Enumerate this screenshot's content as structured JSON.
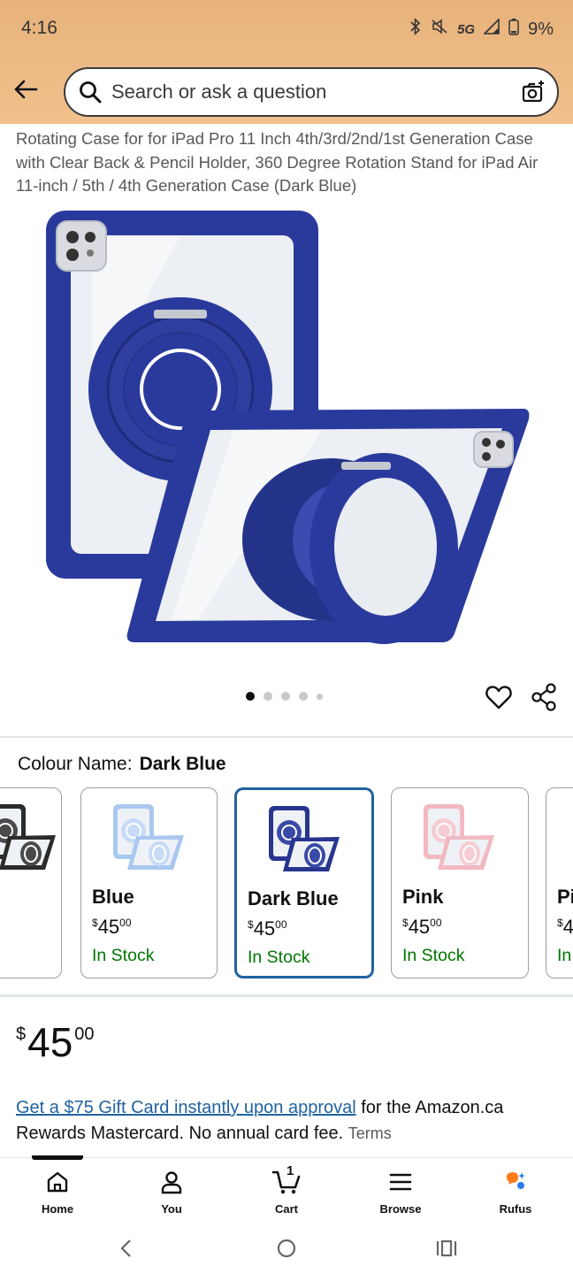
{
  "status_bar": {
    "time": "4:16",
    "network": "5G",
    "battery": "9%"
  },
  "search": {
    "placeholder": "Search or ask a question"
  },
  "product": {
    "title": "Rotating Case for for iPad Pro 11 Inch 4th/3rd/2nd/1st Generation Case with Clear Back & Pencil Holder, 360 Degree Rotation Stand for iPad Air 11-inch / 5th / 4th Generation Case (Dark Blue)",
    "image_count": 5,
    "active_image_index": 0
  },
  "colour": {
    "label": "Colour Name:",
    "value": "Dark Blue",
    "options": [
      {
        "name": "",
        "price_currency": "",
        "price_whole": "",
        "price_fraction": "",
        "stock": "",
        "tint": "#2b2b2b",
        "ring": "#4a4a4a"
      },
      {
        "name": "Blue",
        "price_currency": "$",
        "price_whole": "45",
        "price_fraction": "00",
        "stock": "In Stock",
        "tint": "#a9c8f0",
        "ring": "#c7dbf6"
      },
      {
        "name": "Dark Blue",
        "price_currency": "$",
        "price_whole": "45",
        "price_fraction": "00",
        "stock": "In Stock",
        "tint": "#27358f",
        "ring": "#3a4aa6"
      },
      {
        "name": "Pink",
        "price_currency": "$",
        "price_whole": "45",
        "price_fraction": "00",
        "stock": "In Stock",
        "tint": "#f2b9c2",
        "ring": "#f6cdd3"
      },
      {
        "name": "Pi",
        "price_currency": "$",
        "price_whole": "4",
        "price_fraction": "",
        "stock": "In",
        "tint": "#f2b9c2",
        "ring": "#f6cdd3"
      }
    ],
    "selected_index": 2
  },
  "price": {
    "currency": "$",
    "whole": "45",
    "fraction": "00"
  },
  "promo": {
    "link_text": "Get a $75 Gift Card instantly upon approval",
    "text": " for the Amazon.ca Rewards Mastercard. No annual card fee. ",
    "terms": "Terms"
  },
  "bottom_nav": {
    "items": [
      {
        "label": "Home",
        "icon": "home-icon"
      },
      {
        "label": "You",
        "icon": "person-icon"
      },
      {
        "label": "Cart",
        "icon": "cart-icon",
        "badge": "1"
      },
      {
        "label": "Browse",
        "icon": "menu-icon"
      },
      {
        "label": "Rufus",
        "icon": "rufus-icon"
      }
    ]
  },
  "colors": {
    "header": "#edbb86",
    "link": "#2162a1",
    "in_stock": "#007600",
    "selected_border": "#2162a1",
    "case_blue": "#2a3a9c"
  }
}
